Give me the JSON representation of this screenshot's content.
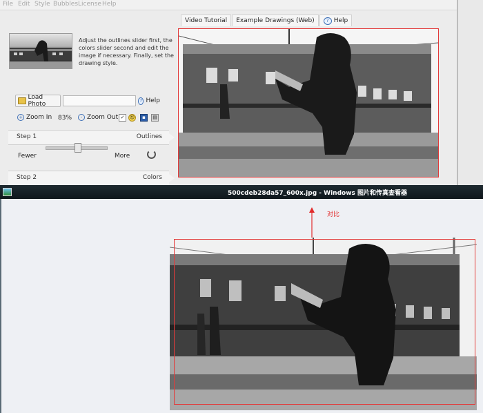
{
  "menu": [
    "File",
    "Edit",
    "Style",
    "Bubbles",
    "License",
    "Help"
  ],
  "top_tabs": {
    "video_tutorial": "Video Tutorial",
    "example_drawings": "Example Drawings (Web)",
    "help": "Help"
  },
  "instructions": "Adjust the outlines slider first, the colors slider second and edit the image if necessary. Finally, set the drawing style.",
  "load_photo": {
    "label": "Load Photo",
    "path_value": "",
    "help_label": "Help"
  },
  "zoom": {
    "zoom_in": "Zoom In",
    "level": "83%",
    "zoom_out": "Zoom Out"
  },
  "step1": {
    "title": "Step 1",
    "right": "Outlines",
    "fewer": "Fewer",
    "more": "More",
    "slider_value_fraction": 0.5
  },
  "step2": {
    "title": "Step 2",
    "right": "Colors"
  },
  "viewer": {
    "title": "500cdeb28da57_600x.jpg - Windows 图片和传真查看器"
  },
  "annotation": {
    "compare": "对比"
  },
  "colors": {
    "accent_red": "#e23a3a",
    "viewer_bar": "#0f171b"
  },
  "icons": [
    "folder-icon",
    "help-icon",
    "zoom-in-icon",
    "zoom-out-icon",
    "checkbox-icon",
    "smiley-icon",
    "save-icon",
    "print-icon",
    "reset-icon",
    "viewer-app-icon"
  ]
}
